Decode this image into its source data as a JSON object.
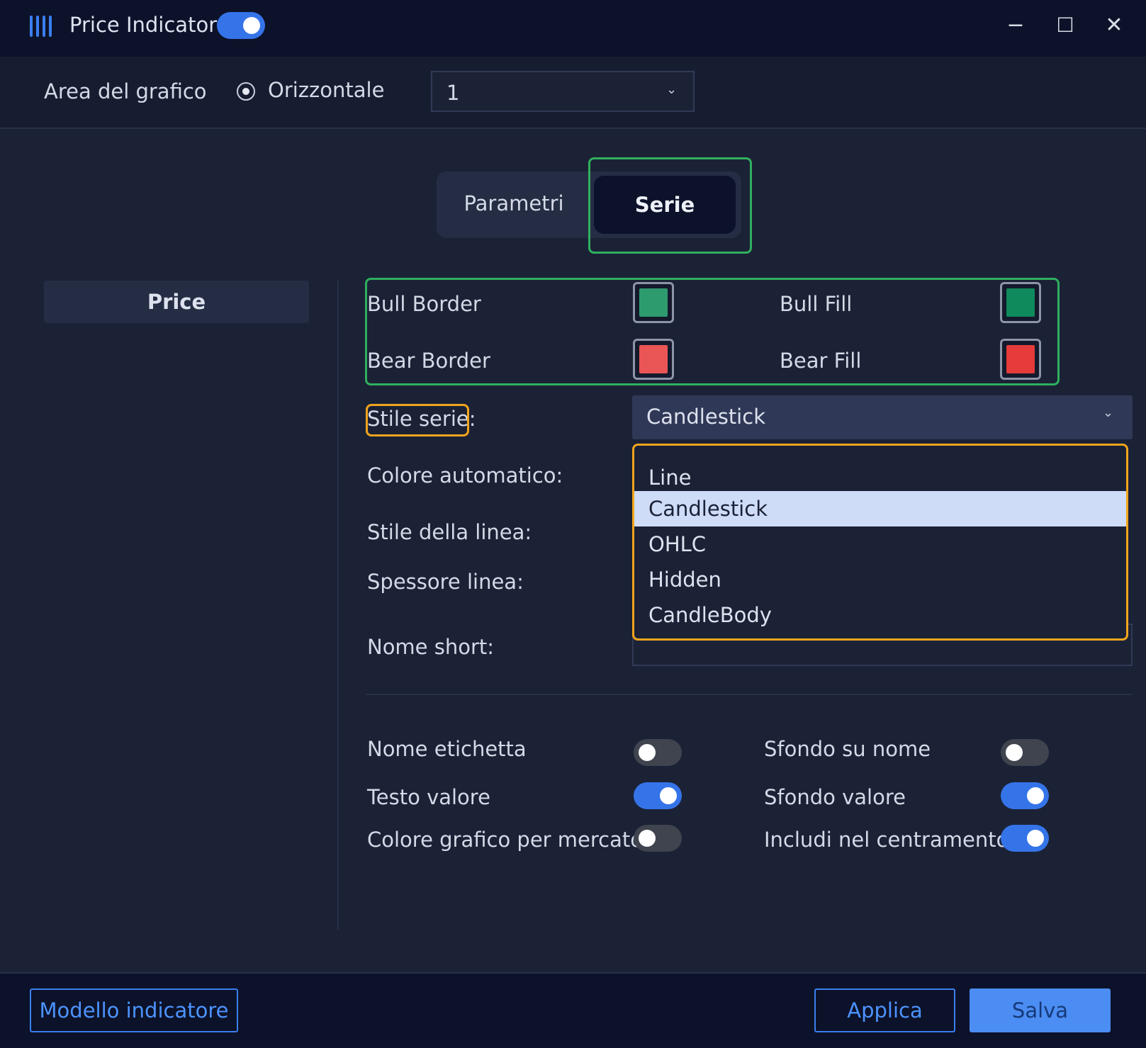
{
  "window": {
    "title": "Price Indicator",
    "indicator_enabled": true,
    "minimize_glyph": "−",
    "maximize_glyph": "☐",
    "close_glyph": "✕"
  },
  "toolbar": {
    "area_label": "Area del grafico",
    "orientation_label": "Orizzontale",
    "area_value": "1"
  },
  "tabs": [
    {
      "label": "Parametri",
      "active": false
    },
    {
      "label": "Serie",
      "active": true
    }
  ],
  "sidebar": {
    "items": [
      {
        "label": "Price",
        "selected": true
      }
    ]
  },
  "colors": {
    "bull_border_label": "Bull Border",
    "bull_border_color": "#2e9b6e",
    "bull_fill_label": "Bull Fill",
    "bull_fill_color": "#0f8a5c",
    "bear_border_label": "Bear Border",
    "bear_border_color": "#ea5555",
    "bear_fill_label": "Bear Fill",
    "bear_fill_color": "#e53b3b"
  },
  "form": {
    "series_style_label": "Stile serie:",
    "series_style_value": "Candlestick",
    "auto_color_label": "Colore automatico:",
    "line_style_label": "Stile della linea:",
    "line_width_label": "Spessore linea:",
    "short_name_label": "Nome short:"
  },
  "dropdown": {
    "options": [
      "Line",
      "Candlestick",
      "OHLC",
      "Hidden",
      "CandleBody"
    ],
    "selected": "Candlestick"
  },
  "toggles": {
    "label_name": {
      "label": "Nome etichetta",
      "on": false
    },
    "value_text": {
      "label": "Testo valore",
      "on": true
    },
    "market_chart_color": {
      "label": "Colore grafico per mercato",
      "on": false
    },
    "name_background": {
      "label": "Sfondo su nome",
      "on": false
    },
    "value_background": {
      "label": "Sfondo valore",
      "on": true
    },
    "include_centering": {
      "label": "Includi nel centramento",
      "on": true
    }
  },
  "footer": {
    "template_label": "Modello indicatore",
    "apply_label": "Applica",
    "save_label": "Salva"
  },
  "accent_colors": {
    "primary": "#3574e8",
    "highlight_green": "#2faf5e",
    "highlight_orange": "#f2a51c"
  }
}
